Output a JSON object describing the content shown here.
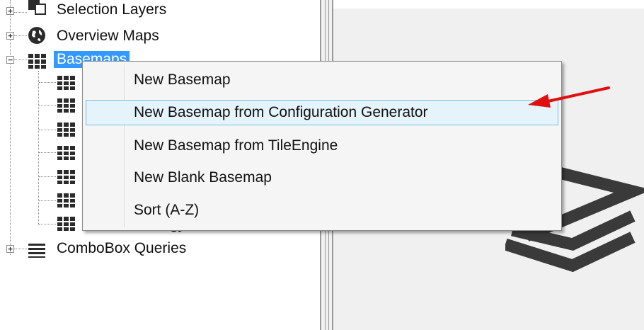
{
  "tree": {
    "nodes": [
      {
        "label": "Selection Layers",
        "icon": "selection-layers-icon",
        "expander": "+"
      },
      {
        "label": "Overview Maps",
        "icon": "globe-icon",
        "expander": "+"
      },
      {
        "label": "Basemaps",
        "icon": "basemap-grid-icon",
        "expander": "−",
        "selected": true
      },
      {
        "label": "ComboBox Queries",
        "icon": "list-icon",
        "expander": "+"
      }
    ],
    "partial_child_text": "gy"
  },
  "context_menu": {
    "items": [
      {
        "label": "New Basemap",
        "highlighted": false
      },
      {
        "label": "New Basemap from Configuration Generator",
        "highlighted": true
      },
      {
        "label": "New Basemap from TileEngine",
        "highlighted": false
      },
      {
        "label": "New Blank Basemap",
        "highlighted": false
      },
      {
        "label": "Sort (A-Z)",
        "highlighted": false
      }
    ]
  },
  "colors": {
    "selection": "#3399ff",
    "menu_highlight": "#e5f3fb",
    "menu_highlight_border": "#70c0e7",
    "annotation_arrow": "#e01010",
    "logo": "#3a3a3a"
  },
  "right_pane": {
    "logo_icon": "layers-stack-icon"
  }
}
